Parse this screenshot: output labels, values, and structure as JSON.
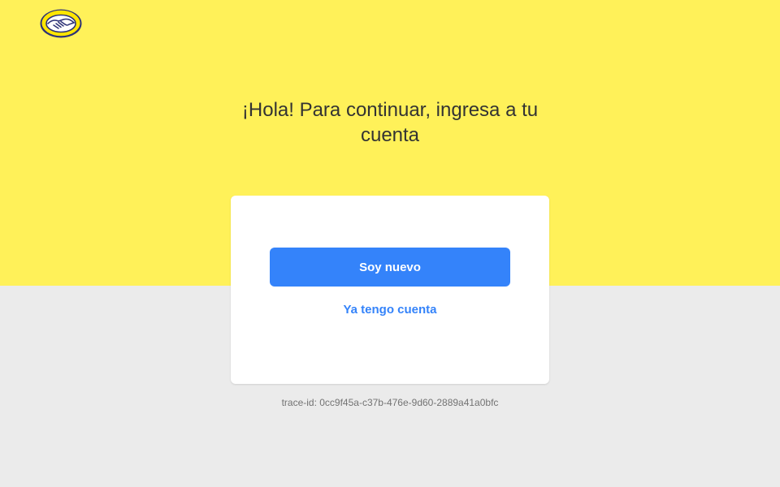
{
  "brand": {
    "logo_icon": "handshake-logo-icon",
    "colors": {
      "header_yellow": "#fff159",
      "background_gray": "#ebebeb",
      "primary_blue": "#3483fa",
      "text_dark": "#333333",
      "text_muted": "#737373"
    }
  },
  "main": {
    "headline": "¡Hola! Para continuar, ingresa a tu cuenta"
  },
  "card": {
    "primary_button_label": "Soy nuevo",
    "secondary_link_label": "Ya tengo cuenta"
  },
  "footer": {
    "trace_id": "trace-id: 0cc9f45a-c37b-476e-9d60-2889a41a0bfc"
  }
}
